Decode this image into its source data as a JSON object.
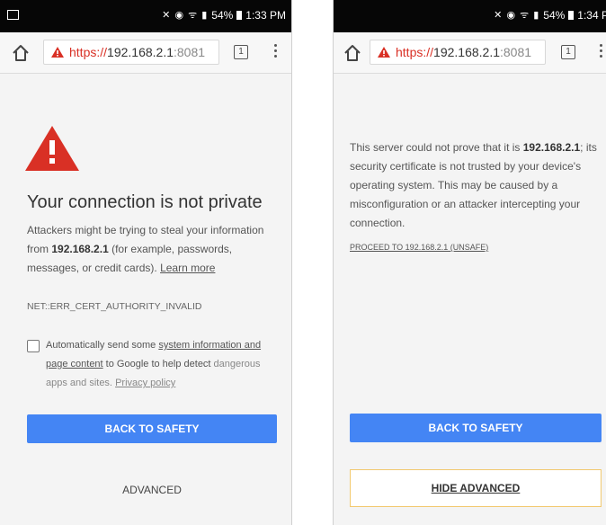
{
  "left": {
    "status_time": "1:33 PM",
    "status_battery": "54%",
    "url": {
      "scheme": "https://",
      "host": "192.168.2.1",
      "port": ":8081"
    },
    "tab_count": "1",
    "headline": "Your connection is not private",
    "body": {
      "part1": "Attackers might be trying to steal your information from ",
      "host_bold": "192.168.2.1",
      "part2": " (for example, passwords, messages, or credit cards). ",
      "learn_more": "Learn more"
    },
    "error_code": "NET::ERR_CERT_AUTHORITY_INVALID",
    "checkbox": {
      "checked": false,
      "text1": "Automatically send some ",
      "link1": "system information and page content",
      "text2": " to Google to help detect ",
      "text3": "dangerous apps and sites. ",
      "privacy_link": "Privacy policy"
    },
    "back_button": "BACK TO SAFETY",
    "advanced_button": "ADVANCED"
  },
  "right": {
    "status_time": "1:34 P",
    "status_battery": "54%",
    "url": {
      "scheme": "https://",
      "host": "192.168.2.1",
      "port": ":8081"
    },
    "tab_count": "1",
    "body": {
      "part1": "This server could not prove that it is ",
      "host_bold": "192.168.2.1",
      "part2": "; its security certificate is not trusted by your device's operating system. This may be caused by a misconfiguration or an attacker intercepting your connection."
    },
    "proceed_link": "PROCEED TO 192.168.2.1 (UNSAFE)",
    "back_button": "BACK TO SAFETY",
    "hide_advanced_button": "HIDE ADVANCED"
  },
  "colors": {
    "primary_button": "#4485f4",
    "warning_red": "#d93025",
    "highlight_border": "#f2c96f",
    "status_bar": "#060606"
  },
  "icons": [
    "screenshot-icon",
    "mute-icon",
    "alarm-icon",
    "wifi-icon",
    "signal-icon",
    "battery-icon",
    "home-icon",
    "warning-icon",
    "tab-switcher-icon",
    "overflow-menu-icon"
  ]
}
